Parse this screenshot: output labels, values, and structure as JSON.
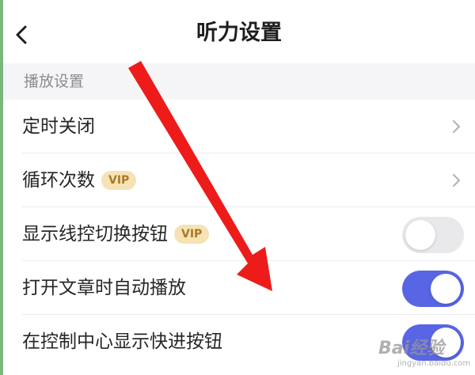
{
  "header": {
    "title": "听力设置",
    "back_icon": "chevron-left-icon"
  },
  "section": {
    "title": "播放设置"
  },
  "rows": [
    {
      "label": "定时关闭",
      "vip": "",
      "control": "chevron"
    },
    {
      "label": "循环次数",
      "vip": "VIP",
      "control": "chevron"
    },
    {
      "label": "显示线控切换按钮",
      "vip": "VIP",
      "control": "toggle",
      "on": false
    },
    {
      "label": "打开文章时自动播放",
      "vip": "",
      "control": "toggle",
      "on": true
    },
    {
      "label": "在控制中心显示快进按钮",
      "vip": "",
      "control": "toggle",
      "on": true
    }
  ],
  "colors": {
    "accent": "#5865e4",
    "toggle_off": "#e9e9ec",
    "vip_badge_bg": "#f6e2b4",
    "vip_badge_text": "#a87a28",
    "annotation_arrow": "#ee1b1b"
  },
  "watermark": {
    "logo": "Bai经验",
    "url": "jingyan.baidu.com"
  }
}
